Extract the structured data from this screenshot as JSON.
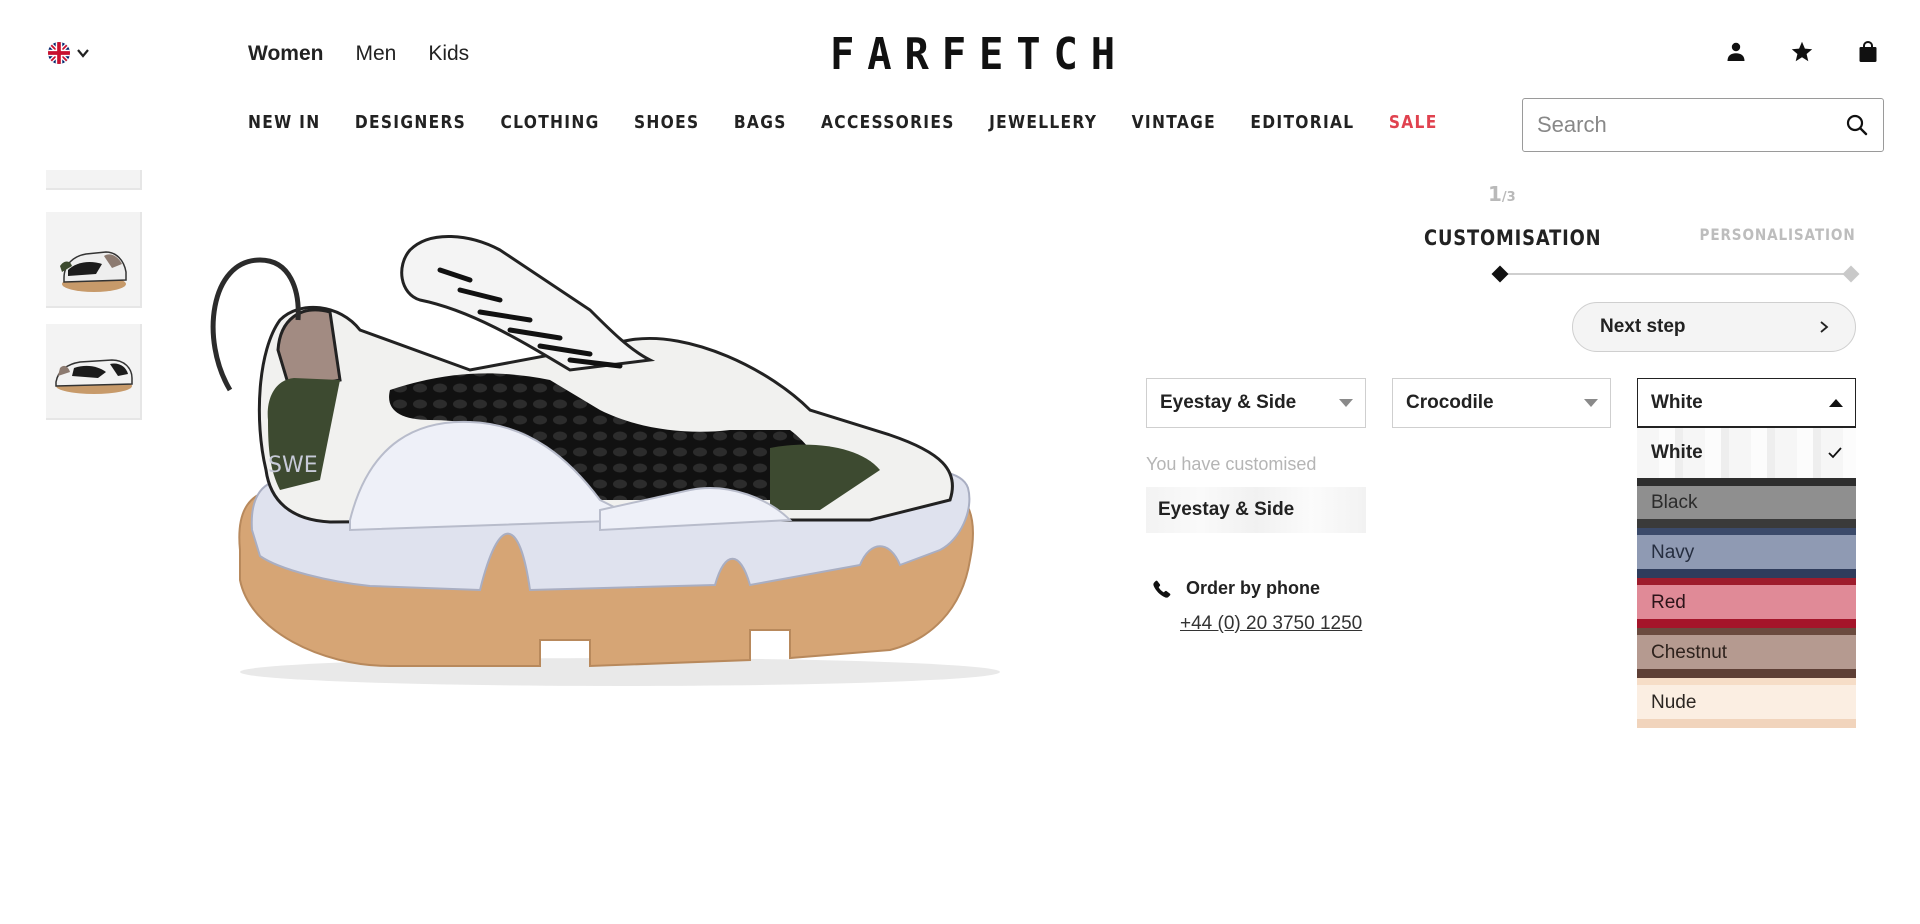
{
  "header": {
    "locale_icon": "uk-flag-icon",
    "gender_nav": [
      {
        "label": "Women",
        "active": true
      },
      {
        "label": "Men",
        "active": false
      },
      {
        "label": "Kids",
        "active": false
      }
    ],
    "logo": "FARFETCH",
    "icons": [
      "account-icon",
      "wishlist-star-icon",
      "shopping-bag-icon"
    ]
  },
  "category_nav": [
    {
      "label": "NEW IN"
    },
    {
      "label": "DESIGNERS"
    },
    {
      "label": "CLOTHING"
    },
    {
      "label": "SHOES"
    },
    {
      "label": "BAGS"
    },
    {
      "label": "ACCESSORIES"
    },
    {
      "label": "JEWELLERY"
    },
    {
      "label": "VINTAGE"
    },
    {
      "label": "EDITORIAL"
    },
    {
      "label": "SALE",
      "color": "#e0424f"
    }
  ],
  "search": {
    "placeholder": "Search"
  },
  "customizer": {
    "step_current": "1",
    "step_total": "/3",
    "step_title": "CUSTOMISATION",
    "next_step_title": "PERSONALISATION",
    "next_button": "Next step",
    "selects": {
      "part": "Eyestay & Side",
      "material": "Crocodile",
      "colour": "White"
    },
    "customised_label": "You have customised",
    "customised_item": "Eyestay & Side",
    "order_label": "Order by phone",
    "phone": "+44 (0) 20 3750 1250",
    "colour_options": [
      {
        "label": "White",
        "selected": true
      },
      {
        "label": "Black",
        "selected": false
      },
      {
        "label": "Navy",
        "selected": false
      },
      {
        "label": "Red",
        "selected": false
      },
      {
        "label": "Chestnut",
        "selected": false
      },
      {
        "label": "Nude",
        "selected": false
      }
    ]
  },
  "colors": {
    "accent_sale": "#e0424f",
    "text": "#222222",
    "muted": "#b5b5b5"
  }
}
